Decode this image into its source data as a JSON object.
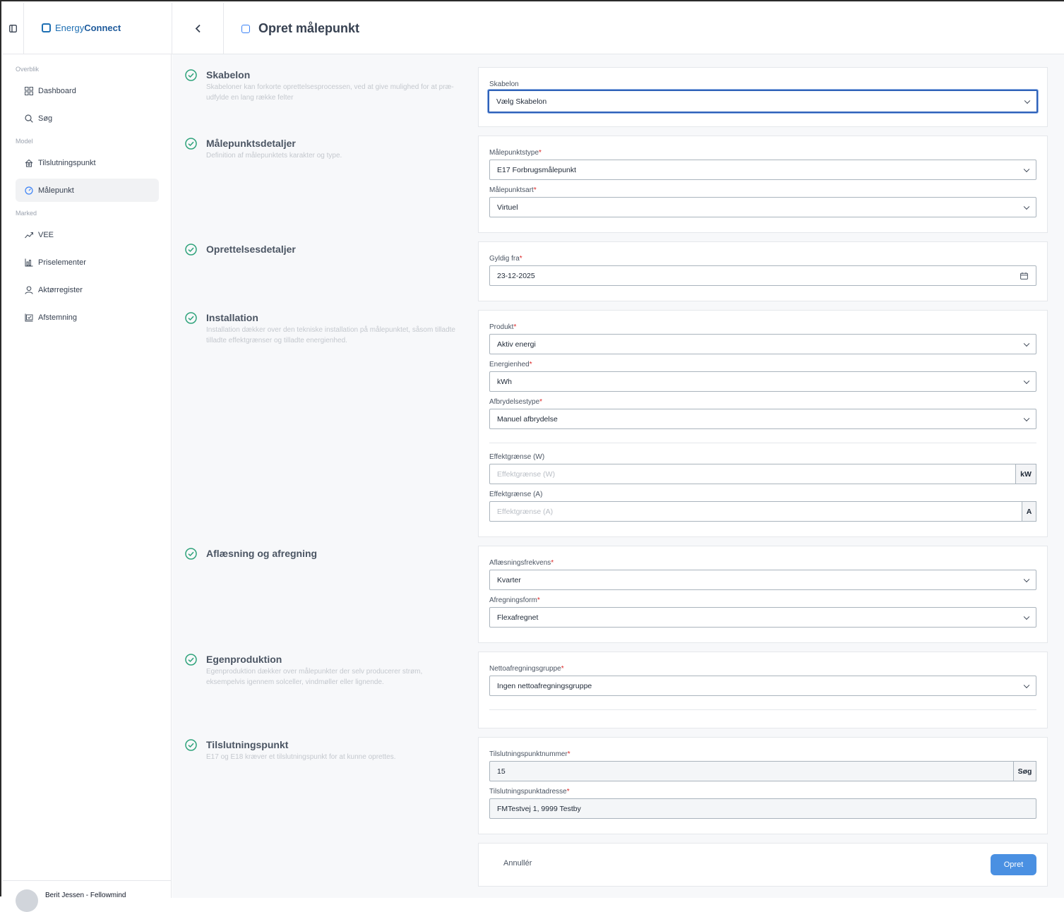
{
  "app": {
    "logo_part1": "Energy",
    "logo_part2": "Connect"
  },
  "header": {
    "title": "Opret målepunkt"
  },
  "sidebar": {
    "sections": [
      "Overblik",
      "Model",
      "Marked"
    ],
    "items": [
      {
        "label": "Dashboard",
        "icon": "grid-icon"
      },
      {
        "label": "Søg",
        "icon": "search-icon"
      },
      {
        "label": "Tilslutningspunkt",
        "icon": "house-icon"
      },
      {
        "label": "Målepunkt",
        "icon": "gauge-icon",
        "active": true
      },
      {
        "label": "VEE",
        "icon": "trend-icon"
      },
      {
        "label": "Priselementer",
        "icon": "bar-chart-icon"
      },
      {
        "label": "Aktørregister",
        "icon": "user-icon"
      },
      {
        "label": "Afstemning",
        "icon": "chart-check-icon"
      }
    ],
    "user": "Berit Jessen - Fellowmind"
  },
  "sections": {
    "skabelon": {
      "title": "Skabelon",
      "desc": "Skabeloner kan forkorte oprettelsesprocessen, ved at give mulighed for at præ-udfylde en lang række felter"
    },
    "detaljer": {
      "title": "Målepunktsdetaljer",
      "desc": "Definition af målepunktets karakter og type."
    },
    "oprettelse": {
      "title": "Oprettelsesdetaljer"
    },
    "installation": {
      "title": "Installation",
      "desc": "Installation dækker over den tekniske installation på målepunktet, såsom tilladte tilladte effektgrænser og tilladte energienhed."
    },
    "aflaesning": {
      "title": "Aflæsning og afregning"
    },
    "egenproduktion": {
      "title": "Egenproduktion",
      "desc": "Egenproduktion dækker over målepunkter der selv producerer strøm, eksempelvis igennem solceller, vindmøller eller lignende."
    },
    "tilslutning": {
      "title": "Tilslutningspunkt",
      "desc": "E17 og E18 kræver et tilslutningspunkt for at kunne oprettes."
    }
  },
  "form": {
    "skabelon": {
      "label": "Skabelon",
      "value": "Vælg Skabelon"
    },
    "malepunktstype": {
      "label": "Målepunktstype",
      "value": "E17 Forbrugsmålepunkt"
    },
    "malepunktsart": {
      "label": "Målepunktsart",
      "value": "Virtuel"
    },
    "gyldig_fra": {
      "label": "Gyldig fra",
      "value": "23-12-2025"
    },
    "produkt": {
      "label": "Produkt",
      "value": "Aktiv energi"
    },
    "energienhed": {
      "label": "Energienhed",
      "value": "kWh"
    },
    "afbrydelsestype": {
      "label": "Afbrydelsestype",
      "value": "Manuel afbrydelse"
    },
    "effekt_w": {
      "label": "Effektgrænse (W)",
      "placeholder": "Effektgrænse (W)",
      "unit": "kW"
    },
    "effekt_a": {
      "label": "Effektgrænse (A)",
      "placeholder": "Effektgrænse (A)",
      "unit": "A"
    },
    "aflaesningsfrekvens": {
      "label": "Aflæsningsfrekvens",
      "value": "Kvarter"
    },
    "afregningsform": {
      "label": "Afregningsform",
      "value": "Flexafregnet"
    },
    "nettoafregningsgruppe": {
      "label": "Nettoafregningsgruppe",
      "value": "Ingen nettoafregningsgruppe"
    },
    "tp_nummer": {
      "label": "Tilslutningspunktnummer",
      "value": "15",
      "button": "Søg"
    },
    "tp_adresse": {
      "label": "Tilslutningspunktadresse",
      "value": "FMTestvej 1, 9999 Testby"
    }
  },
  "actions": {
    "cancel": "Annullér",
    "submit": "Opret"
  },
  "colors": {
    "accent": "#4a90e2",
    "check": "#2fa37b",
    "required": "#dc2626",
    "brand": "#1e6fb3"
  }
}
